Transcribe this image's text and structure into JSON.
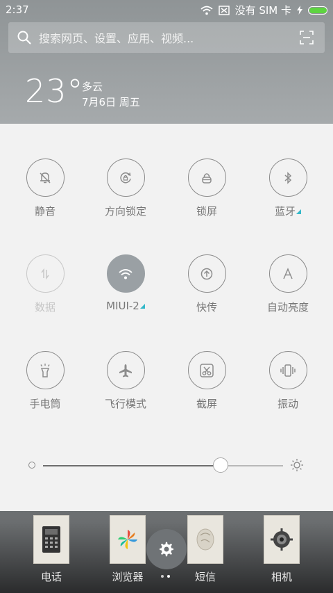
{
  "status_bar": {
    "time": "2:37",
    "sim_text": "没有 SIM 卡",
    "battery_level": 1.0,
    "icons": [
      "wifi-icon",
      "no-sim-icon",
      "charging-icon",
      "battery-icon"
    ]
  },
  "search": {
    "placeholder": "搜索网页、设置、应用、视频...",
    "icon": "search-icon",
    "scan_icon": "scan-icon"
  },
  "weather": {
    "temperature": "23°",
    "condition": "多云",
    "date": "7月6日 周五"
  },
  "toggles": [
    {
      "label": "静音",
      "icon": "bell-slash-icon",
      "state": "off"
    },
    {
      "label": "方向锁定",
      "icon": "rotation-lock-icon",
      "state": "off"
    },
    {
      "label": "锁屏",
      "icon": "lock-icon",
      "state": "off"
    },
    {
      "label": "蓝牙",
      "icon": "bluetooth-icon",
      "state": "off",
      "has_more": true
    },
    {
      "label": "数据",
      "icon": "data-icon",
      "state": "disabled"
    },
    {
      "label": "MIUI-2",
      "icon": "wifi-icon",
      "state": "on",
      "has_more": true
    },
    {
      "label": "快传",
      "icon": "share-icon",
      "state": "off"
    },
    {
      "label": "自动亮度",
      "icon": "auto-brightness-icon",
      "state": "off"
    },
    {
      "label": "手电筒",
      "icon": "flashlight-icon",
      "state": "off"
    },
    {
      "label": "飞行模式",
      "icon": "airplane-icon",
      "state": "off"
    },
    {
      "label": "截屏",
      "icon": "screenshot-icon",
      "state": "off"
    },
    {
      "label": "振动",
      "icon": "vibrate-icon",
      "state": "off"
    }
  ],
  "brightness": {
    "level": 0.74
  },
  "dock": {
    "apps": [
      {
        "label": "电话",
        "icon": "phone-icon"
      },
      {
        "label": "浏览器",
        "icon": "browser-icon"
      },
      {
        "label": "短信",
        "icon": "messages-icon"
      },
      {
        "label": "相机",
        "icon": "camera-icon"
      }
    ],
    "settings_icon": "gear-icon",
    "page_count": 2,
    "current_page": 1
  },
  "colors": {
    "accent_triangle": "#33b8c9",
    "battery": "#5ed441",
    "active_toggle": "#9aa0a4"
  }
}
